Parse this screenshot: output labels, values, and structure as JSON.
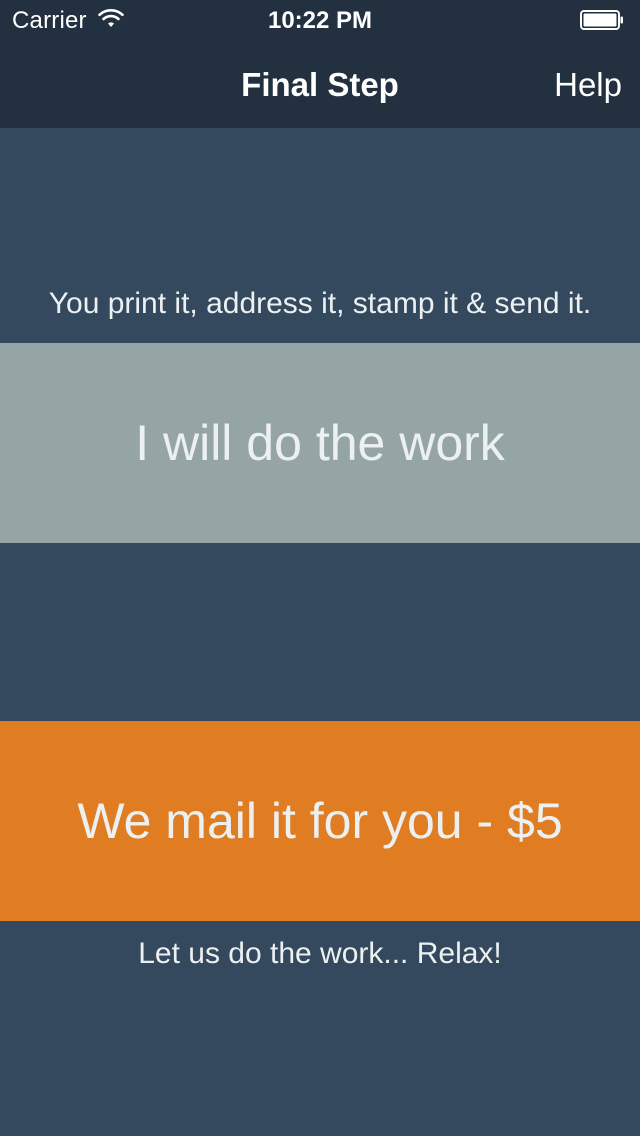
{
  "status_bar": {
    "carrier": "Carrier",
    "time": "10:22 PM",
    "wifi_icon": "wifi-icon",
    "battery_icon": "battery-icon"
  },
  "nav": {
    "title": "Final Step",
    "help_label": "Help"
  },
  "options": {
    "self": {
      "caption": "You print it, address it, stamp it & send it.",
      "label": "I will do the work",
      "color": "#95a5a6"
    },
    "mail": {
      "label": "We mail it for you - $5",
      "caption": "Let us do the work... Relax!",
      "color": "#e07d22"
    }
  },
  "colors": {
    "background": "#34495e",
    "nav_background": "#22303f",
    "text": "#ecf0f1"
  }
}
